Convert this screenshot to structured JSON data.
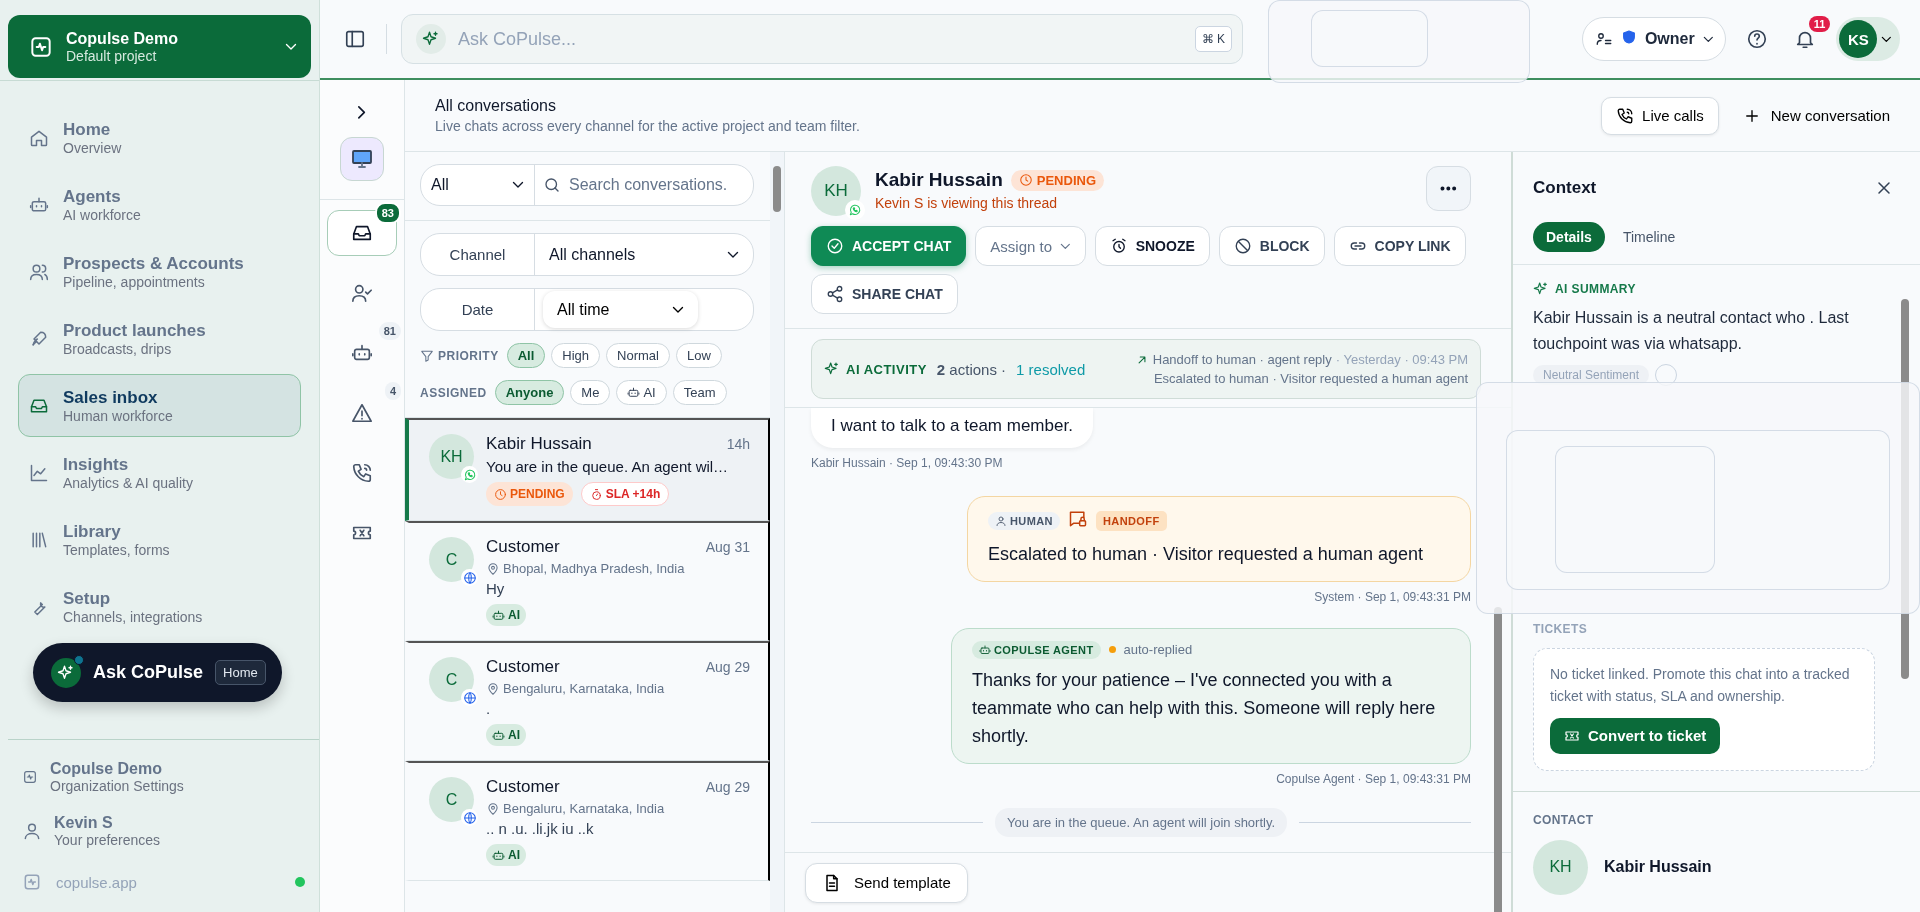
{
  "workspace": {
    "name": "Copulse Demo",
    "subtitle": "Default project"
  },
  "nav": [
    {
      "title": "Home",
      "subtitle": "Overview",
      "selected": false
    },
    {
      "title": "Agents",
      "subtitle": "AI workforce",
      "selected": false
    },
    {
      "title": "Prospects & Accounts",
      "subtitle": "Pipeline, appointments",
      "selected": false
    },
    {
      "title": "Product launches",
      "subtitle": "Broadcasts, drips",
      "selected": false
    },
    {
      "title": "Sales inbox",
      "subtitle": "Human workforce",
      "selected": true
    },
    {
      "title": "Insights",
      "subtitle": "Analytics & AI quality",
      "selected": false
    },
    {
      "title": "Library",
      "subtitle": "Templates, forms",
      "selected": false
    },
    {
      "title": "Setup",
      "subtitle": "Channels, integrations",
      "selected": false
    }
  ],
  "ask_copulse": {
    "label": "Ask CoPulse",
    "badge": "Home"
  },
  "footer": [
    {
      "title": "Copulse Demo",
      "subtitle": "Organization Settings"
    },
    {
      "title": "Kevin S",
      "subtitle": "Your preferences"
    }
  ],
  "site": {
    "label": "copulse.app",
    "online": true
  },
  "topbar": {
    "search_placeholder": "Ask CoPulse...",
    "shortcut": "⌘ K",
    "role": "Owner",
    "notifications": "11",
    "avatar": "KS"
  },
  "rail": [
    {
      "selected": true,
      "badge": "83"
    },
    {
      "selected": false
    },
    {
      "selected": false,
      "badge": "81"
    },
    {
      "selected": false,
      "badge": "4"
    },
    {
      "selected": false
    },
    {
      "selected": false
    }
  ],
  "page": {
    "title": "All conversations",
    "subtitle": "Live chats across every channel for the active project and team filter.",
    "live_calls": "Live calls",
    "new_conversation": "New conversation"
  },
  "filters": {
    "scope": "All",
    "search_placeholder": "Search conversations.",
    "channel": {
      "label": "Channel",
      "value": "All channels"
    },
    "date": {
      "label": "Date",
      "value": "All time"
    },
    "priority": {
      "label": "PRIORITY",
      "options": [
        {
          "label": "All",
          "selected": true
        },
        {
          "label": "High",
          "selected": false
        },
        {
          "label": "Normal",
          "selected": false
        },
        {
          "label": "Low",
          "selected": false
        }
      ]
    },
    "assigned": {
      "label": "ASSIGNED",
      "options": [
        {
          "label": "Anyone",
          "selected": true
        },
        {
          "label": "Me",
          "selected": false
        },
        {
          "label": "AI",
          "selected": false,
          "kind": "ai"
        },
        {
          "label": "Team",
          "selected": false
        }
      ]
    }
  },
  "conversations": [
    {
      "initials": "KH",
      "kind": "whatsapp",
      "name": "Kabir Hussain",
      "time": "14h",
      "preview": "You are in the queue. An agent wil…",
      "selected": true,
      "tags": [
        {
          "label": "PENDING",
          "kind": "pending"
        },
        {
          "label": "SLA +14h",
          "kind": "sla"
        }
      ]
    },
    {
      "initials": "C",
      "kind": "web",
      "name": "Customer",
      "time": "Aug 31",
      "location": "Bhopal, Madhya Pradesh, India",
      "preview": "Hy",
      "selected": false,
      "tags": [
        {
          "label": "AI",
          "kind": "ai"
        }
      ]
    },
    {
      "initials": "C",
      "kind": "web",
      "name": "Customer",
      "time": "Aug 29",
      "location": "Bengaluru, Karnataka, India",
      "preview": ".",
      "selected": false,
      "tags": [
        {
          "label": "AI",
          "kind": "ai"
        }
      ]
    },
    {
      "initials": "C",
      "kind": "web",
      "name": "Customer",
      "time": "Aug 29",
      "location": "Bengaluru, Karnataka, India",
      "preview": ".. n .u. .li.jk iu ..k",
      "selected": false,
      "tags": [
        {
          "label": "AI",
          "kind": "ai"
        }
      ]
    }
  ],
  "chat": {
    "initials": "KH",
    "kind": "whatsapp",
    "name": "Kabir Hussain",
    "status": "PENDING",
    "viewing": "Kevin S is viewing this thread",
    "actions": [
      {
        "label": "ACCEPT CHAT",
        "kind": "accept"
      },
      {
        "label": "Assign to",
        "kind": "assign"
      },
      {
        "label": "SNOOZE",
        "kind": "snooze"
      },
      {
        "label": "BLOCK",
        "kind": "block"
      },
      {
        "label": "COPY LINK",
        "kind": "link"
      },
      {
        "label": "SHARE CHAT",
        "kind": "share"
      }
    ],
    "ai_activity": {
      "label": "AI ACTIVITY",
      "count": "**2** actions ·",
      "resolved": "1 resolved",
      "latest": "Handoff to human · agent reply",
      "when": "· Yesterday · 09:43 PM",
      "detail": "Escalated to human · Visitor requested a human agent"
    },
    "messages": [
      {
        "kind": "visitor",
        "text": "I want to talk to a team member.",
        "meta": "Kabir Hussain · Sep 1, 09:43:30 PM"
      },
      {
        "kind": "system",
        "role": "HUMAN",
        "tag": "HANDOFF",
        "text": "Escalated to human · Visitor requested a human agent",
        "meta": "System · Sep 1, 09:43:31 PM"
      },
      {
        "kind": "agent",
        "role": "COPULSE AGENT",
        "note": "auto-replied",
        "text": "Thanks for your patience – I've connected you with a teammate who can help with this. Someone will reply here shortly.",
        "meta": "Copulse Agent · Sep 1, 09:43:31 PM"
      },
      {
        "kind": "notice",
        "text": "You are in the queue. An agent will join shortly."
      }
    ],
    "send_template": "Send template"
  },
  "context": {
    "title": "Context",
    "tabs": [
      {
        "label": "Details",
        "selected": true
      },
      {
        "label": "Timeline",
        "selected": false
      }
    ],
    "summary_label": "AI SUMMARY",
    "summary": "Kabir Hussain is a neutral contact who . Last touchpoint was via whatsapp.",
    "sentiment": "Neutral Sentiment",
    "tickets_label": "TICKETS",
    "tickets_text": "No ticket linked. Promote this chat into a tracked ticket with status, SLA and ownership.",
    "convert": "Convert to ticket",
    "contact_label": "CONTACT",
    "contact": {
      "initials": "KH",
      "name": "Kabir Hussain"
    }
  }
}
